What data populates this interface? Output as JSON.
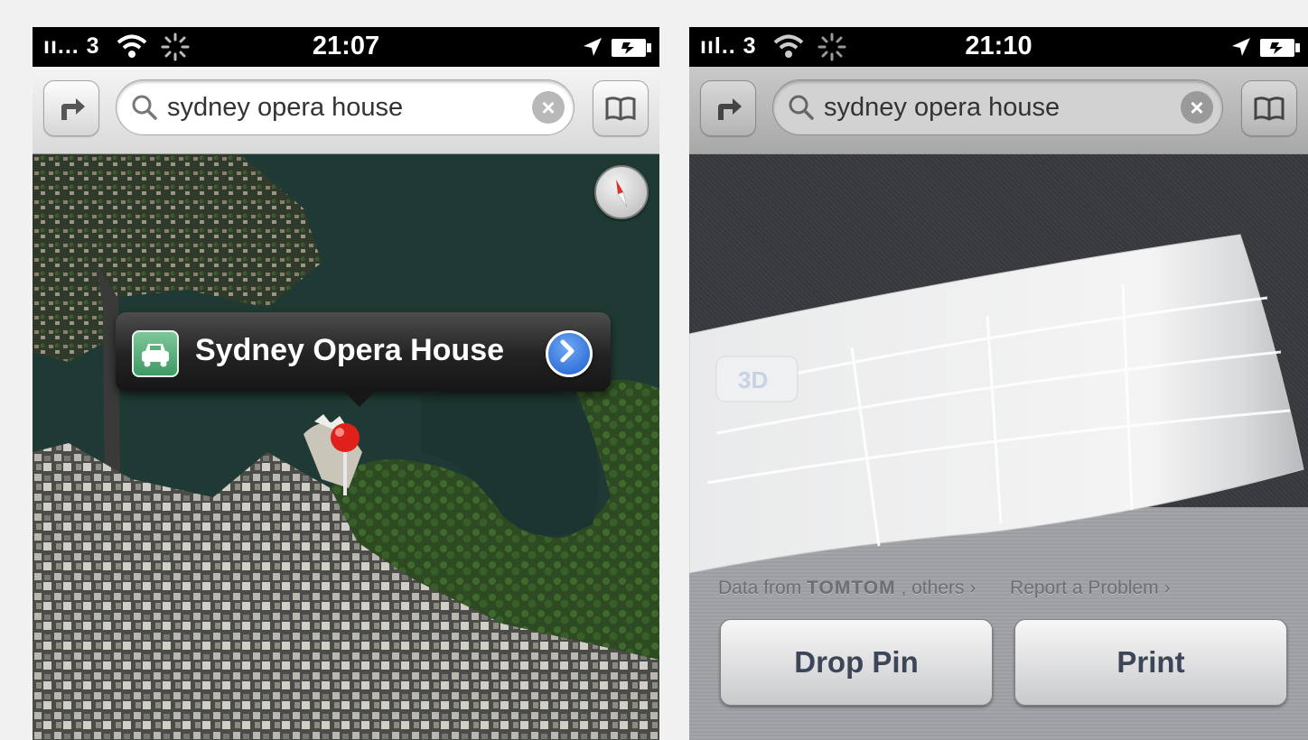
{
  "left_screen": {
    "status": {
      "carrier": "ıı... 3",
      "time": "21:07"
    },
    "search": {
      "query": "sydney opera house"
    },
    "callout": {
      "title": "Sydney Opera House"
    }
  },
  "right_screen": {
    "status": {
      "carrier": "ııl.. 3",
      "time": "21:10"
    },
    "search": {
      "query": "sydney opera house"
    },
    "page_curl": {
      "mode_label": "3D"
    },
    "credits": {
      "data_from": "Data from",
      "brand": "TOMTOM",
      "others": ", others",
      "report": "Report a Problem"
    },
    "buttons": {
      "drop_pin": "Drop Pin",
      "print": "Print"
    }
  },
  "colors": {
    "accent_blue": "#2a6fdc",
    "pin_red": "#e0201a",
    "car_icon_green": "#4aa66e",
    "map_water": "#1f3a34"
  }
}
